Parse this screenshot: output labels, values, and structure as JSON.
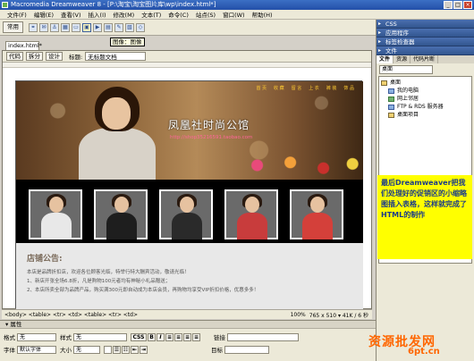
{
  "app": {
    "title": "Macromedia Dreamweaver 8 - [P:\\淘宝\\淘宝图片库\\wp\\index.html*]",
    "window_buttons": [
      "_",
      "□",
      "×"
    ]
  },
  "menu": [
    "文件(F)",
    "编辑(E)",
    "查看(V)",
    "插入(I)",
    "修改(M)",
    "文本(T)",
    "命令(C)",
    "站点(S)",
    "窗口(W)",
    "帮助(H)"
  ],
  "toolbar": {
    "category": "常用",
    "icons": [
      "link-icon",
      "email-icon",
      "anchor-icon",
      "table-icon",
      "layer-icon",
      "image-icon",
      "media-icon",
      "date-icon",
      "comment-icon",
      "template-icon",
      "tag-icon"
    ]
  },
  "tooltip": "图像：图像",
  "document": {
    "tab": "index.html*",
    "views": [
      "代码",
      "拆分",
      "设计"
    ],
    "title_label": "标题:",
    "title_value": "无标题文档"
  },
  "page": {
    "nav": [
      "首 页",
      "收 藏",
      "留 言",
      "上 衣",
      "裤 装",
      "饰 品"
    ],
    "brand": "凤凰社时尚公馆",
    "url": "http://shop35216591.taobao.com",
    "photos": [
      {
        "body": "#e8e8e8"
      },
      {
        "body": "#1e1e1e"
      },
      {
        "body": "#2a2a2a"
      },
      {
        "body": "#c83c3c"
      },
      {
        "body": "#d4403a"
      }
    ],
    "notice_title": "店铺公告:",
    "notice_lines": [
      "本店是品牌折扣店，欢迎各位顾客光临，特举行特大酬宾活动，敬请光临！",
      "1、新店开张全场6.8折，凡是购物100元者均有神秘小礼品赠送；",
      "2、本店所卖全部为品牌产品，购买满300元即自动成为本店会员，再购物均享受VIP折扣价格，优惠多多！"
    ]
  },
  "statusbar": {
    "tags": "<body> <table> <tr> <td> <table> <tr> <td>",
    "zoom": "100%",
    "info": "765 x 510 ▾ 41K / 6 秒"
  },
  "properties": {
    "header": "▾ 属性",
    "format_label": "格式",
    "format_value": "无",
    "style_label": "样式",
    "style_value": "无",
    "css_label": "CSS",
    "font_label": "字体",
    "font_value": "默认字体",
    "size_label": "大小",
    "size_value": "无",
    "link_label": "链接",
    "target_label": "目标",
    "bold": "B",
    "italic": "I"
  },
  "panels": {
    "css": "CSS",
    "app": "应用程序",
    "tag": "标签检查器",
    "files": "文件",
    "file_tabs": [
      "文件",
      "资源",
      "代码片断"
    ],
    "location": "桌面",
    "tree": [
      "桌面",
      "我的电脑",
      "网上邻居",
      "FTP & RDS 服务器",
      "桌面项目"
    ]
  },
  "annotation": "最后Dreamweaver把我们处理好的促销区的小缩略图插入表格，这样就完成了HTML的制作",
  "watermark": "资源批发网",
  "watermark_url": "6pt.cn"
}
